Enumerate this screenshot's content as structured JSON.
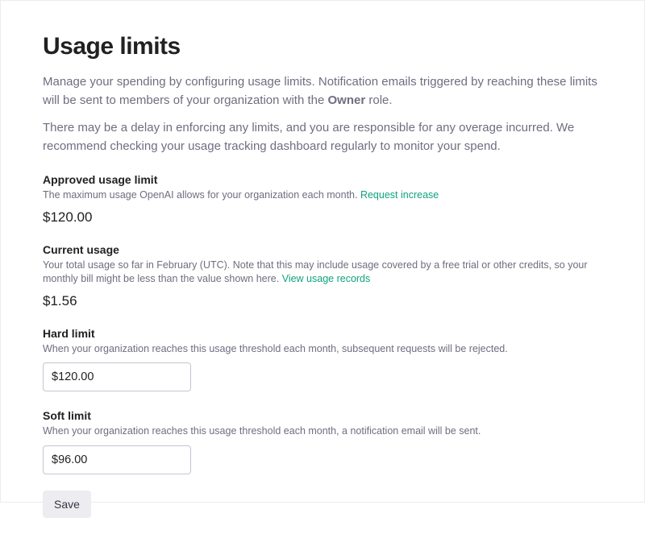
{
  "page": {
    "title": "Usage limits",
    "intro1_pre": "Manage your spending by configuring usage limits. Notification emails triggered by reaching these limits will be sent to members of your organization with the ",
    "intro1_bold": "Owner",
    "intro1_post": " role.",
    "intro2": "There may be a delay in enforcing any limits, and you are responsible for any overage incurred. We recommend checking your usage tracking dashboard regularly to monitor your spend."
  },
  "approved": {
    "title": "Approved usage limit",
    "desc": "The maximum usage OpenAI allows for your organization each month. ",
    "link": "Request increase",
    "value": "$120.00"
  },
  "current": {
    "title": "Current usage",
    "desc": "Your total usage so far in February (UTC). Note that this may include usage covered by a free trial or other credits, so your monthly bill might be less than the value shown here. ",
    "link": "View usage records",
    "value": "$1.56"
  },
  "hard": {
    "title": "Hard limit",
    "desc": "When your organization reaches this usage threshold each month, subsequent requests will be rejected.",
    "value": "$120.00"
  },
  "soft": {
    "title": "Soft limit",
    "desc": "When your organization reaches this usage threshold each month, a notification email will be sent.",
    "value": "$96.00"
  },
  "actions": {
    "save": "Save"
  }
}
